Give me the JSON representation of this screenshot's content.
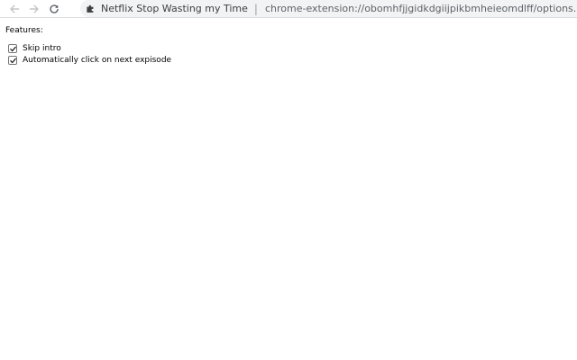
{
  "browser": {
    "site_name": "Netflix Stop Wasting my Time",
    "separator": "|",
    "url": "chrome-extension://obomhfjjgidkdgiijpikbmheieomdlff/options.html",
    "icons": {
      "back": "arrow-left-icon",
      "forward": "arrow-right-icon",
      "reload": "reload-icon",
      "extension": "puzzle-piece-icon"
    }
  },
  "page": {
    "features_label": "Features:",
    "options": [
      {
        "label": "Skip intro",
        "checked": true
      },
      {
        "label": "Automatically click on next expisode",
        "checked": true
      }
    ]
  }
}
